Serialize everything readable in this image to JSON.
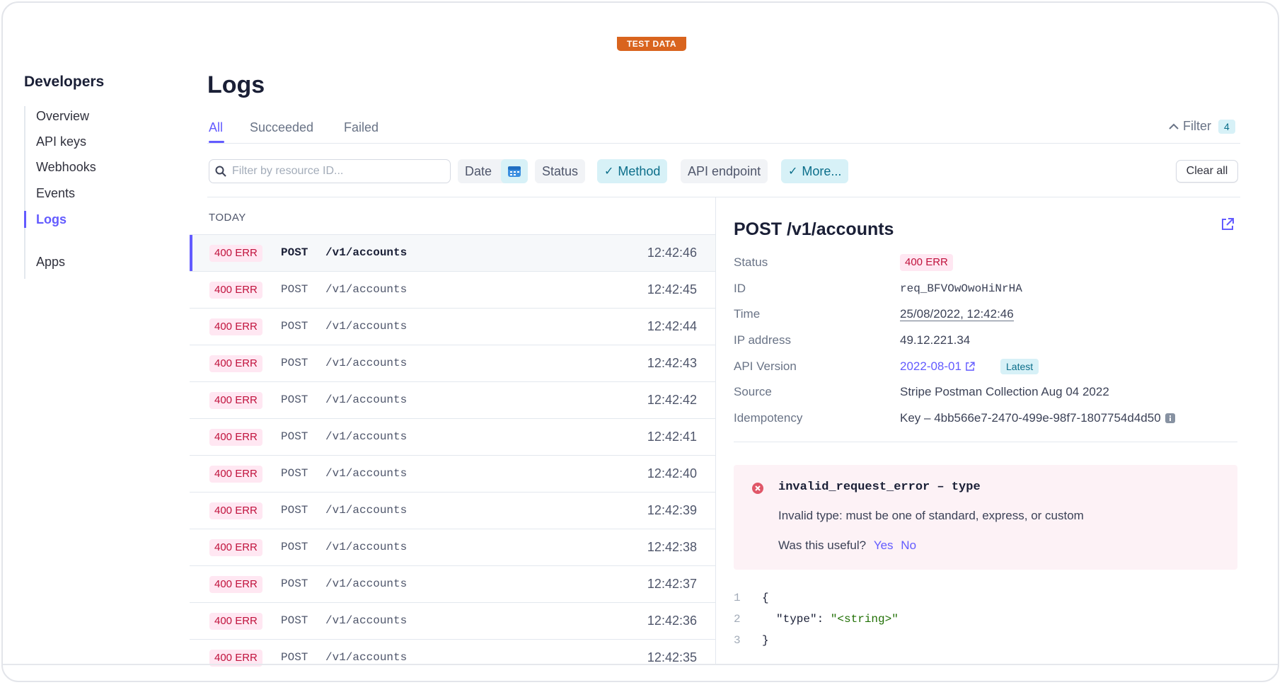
{
  "test_badge": "TEST DATA",
  "sidebar": {
    "title": "Developers",
    "items": [
      {
        "label": "Overview"
      },
      {
        "label": "API keys"
      },
      {
        "label": "Webhooks"
      },
      {
        "label": "Events"
      },
      {
        "label": "Logs",
        "active": true
      },
      {
        "label": "Apps"
      }
    ]
  },
  "page_title": "Logs",
  "tabs": [
    {
      "label": "All",
      "active": true
    },
    {
      "label": "Succeeded"
    },
    {
      "label": "Failed"
    }
  ],
  "filter": {
    "label": "Filter",
    "count": "4"
  },
  "search": {
    "placeholder": "Filter by resource ID..."
  },
  "filters": {
    "date": "Date",
    "status": "Status",
    "method": "Method",
    "api_endpoint": "API endpoint",
    "more": "More...",
    "clear_all": "Clear all"
  },
  "list": {
    "section": "TODAY",
    "rows": [
      {
        "status": "400 ERR",
        "method": "POST",
        "path": "/v1/accounts",
        "time": "12:42:46"
      },
      {
        "status": "400 ERR",
        "method": "POST",
        "path": "/v1/accounts",
        "time": "12:42:45"
      },
      {
        "status": "400 ERR",
        "method": "POST",
        "path": "/v1/accounts",
        "time": "12:42:44"
      },
      {
        "status": "400 ERR",
        "method": "POST",
        "path": "/v1/accounts",
        "time": "12:42:43"
      },
      {
        "status": "400 ERR",
        "method": "POST",
        "path": "/v1/accounts",
        "time": "12:42:42"
      },
      {
        "status": "400 ERR",
        "method": "POST",
        "path": "/v1/accounts",
        "time": "12:42:41"
      },
      {
        "status": "400 ERR",
        "method": "POST",
        "path": "/v1/accounts",
        "time": "12:42:40"
      },
      {
        "status": "400 ERR",
        "method": "POST",
        "path": "/v1/accounts",
        "time": "12:42:39"
      },
      {
        "status": "400 ERR",
        "method": "POST",
        "path": "/v1/accounts",
        "time": "12:42:38"
      },
      {
        "status": "400 ERR",
        "method": "POST",
        "path": "/v1/accounts",
        "time": "12:42:37"
      },
      {
        "status": "400 ERR",
        "method": "POST",
        "path": "/v1/accounts",
        "time": "12:42:36"
      },
      {
        "status": "400 ERR",
        "method": "POST",
        "path": "/v1/accounts",
        "time": "12:42:35"
      }
    ]
  },
  "detail": {
    "title": "POST /v1/accounts",
    "labels": {
      "status": "Status",
      "id": "ID",
      "time": "Time",
      "ip": "IP address",
      "api_version": "API Version",
      "source": "Source",
      "idempotency": "Idempotency"
    },
    "values": {
      "status": "400 ERR",
      "id": "req_BFVOwOwoHiNrHA",
      "time": "25/08/2022, 12:42:46",
      "ip": "49.12.221.34",
      "api_version": "2022-08-01",
      "latest": "Latest",
      "source": "Stripe Postman Collection Aug 04 2022",
      "idempotency": "Key – 4bb566e7-2470-499e-98f7-1807754d4d50"
    },
    "error": {
      "code": "invalid_request_error – type",
      "message": "Invalid type: must be one of standard, express, or custom",
      "useful_prompt": "Was this useful?",
      "yes": "Yes",
      "no": "No"
    },
    "code": {
      "lines": [
        {
          "n": "1",
          "text": "{"
        },
        {
          "n": "2",
          "key": "\"type\": ",
          "value": "\"<string>\""
        },
        {
          "n": "3",
          "text": "}"
        }
      ]
    }
  },
  "colors": {
    "accent": "#635bff",
    "error_bg": "#ffe7f2",
    "error_text": "#c0123c",
    "test_badge": "#d9641e",
    "chip_on": "#d7f1f7"
  }
}
